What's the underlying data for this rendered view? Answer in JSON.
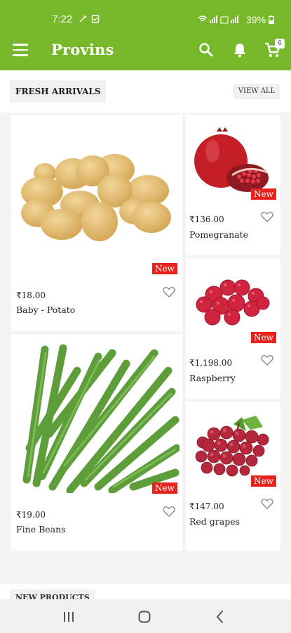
{
  "status": {
    "time": "7:22",
    "battery": "39%"
  },
  "appbar": {
    "title": "Provins",
    "cart_count": "6"
  },
  "section": {
    "title": "FRESH ARRIVALS",
    "view_all": "VIEW ALL"
  },
  "products": [
    {
      "badge": "New",
      "price": "₹18.00",
      "name": "Baby - Potato"
    },
    {
      "badge": "New",
      "price": "₹19.00",
      "name": "Fine Beans"
    },
    {
      "badge": "New",
      "price": "₹136.00",
      "name": "Pomegranate"
    },
    {
      "badge": "New",
      "price": "₹1,198.00",
      "name": "Raspberry"
    },
    {
      "badge": "New",
      "price": "₹147.00",
      "name": "Red grapes"
    }
  ],
  "next_section": {
    "title": "NEW PRODUCTS"
  },
  "colors": {
    "brand": "#76b82a",
    "badge": "#e8231e"
  }
}
